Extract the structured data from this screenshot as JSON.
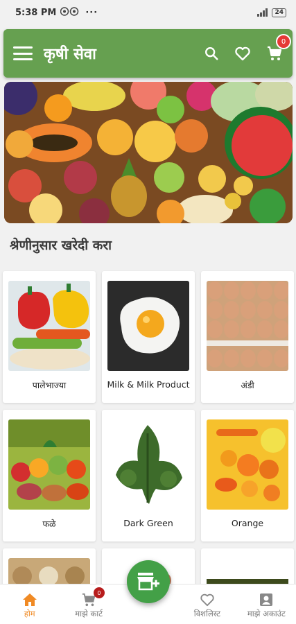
{
  "status_bar": {
    "time": "5:38 PM",
    "battery": "24"
  },
  "app_bar": {
    "title": "कृषी सेवा",
    "cart_count": "0"
  },
  "section_title": "श्रेणीनुसार खरेदी करा",
  "categories": [
    {
      "label": "पालेभाज्या"
    },
    {
      "label": "Milk & Milk Product"
    },
    {
      "label": "अंडी"
    },
    {
      "label": "फळे"
    },
    {
      "label": "Dark Green"
    },
    {
      "label": "Orange"
    }
  ],
  "bottom_nav": {
    "items": [
      {
        "label": "होम"
      },
      {
        "label": "माझे कार्ट",
        "badge": "0"
      },
      {
        "label": "विशलिस्ट"
      },
      {
        "label": "माझे अकाउंट"
      }
    ]
  },
  "colors": {
    "brand": "#66a050",
    "accent": "#f08a24",
    "badge": "#e53935",
    "fab": "#43a047"
  },
  "icons": [
    "menu-icon",
    "search-icon",
    "heart-icon",
    "cart-icon",
    "home-icon",
    "account-icon",
    "store-add-icon"
  ]
}
